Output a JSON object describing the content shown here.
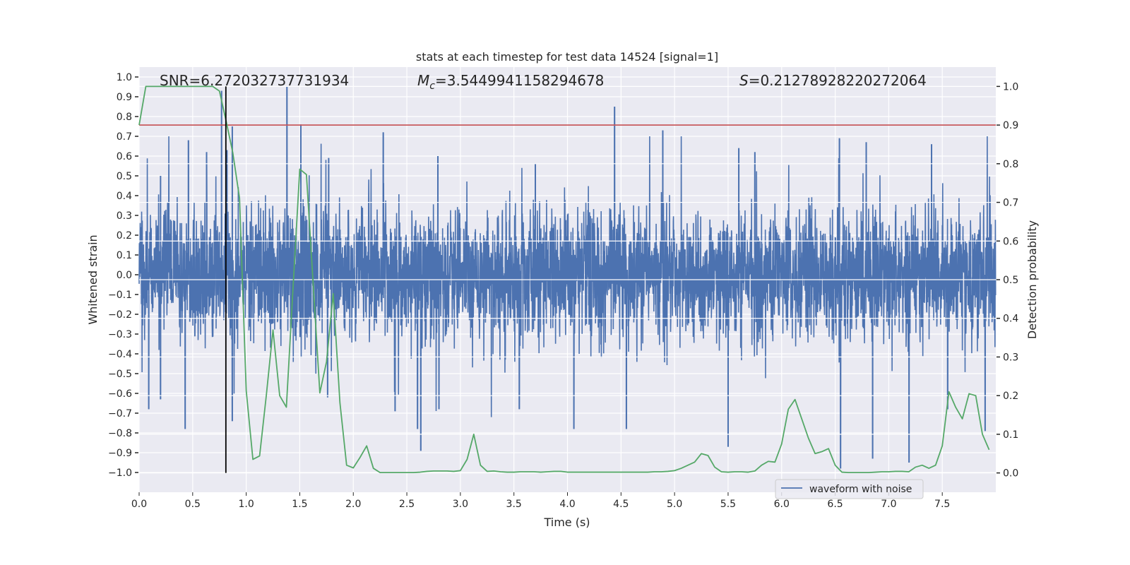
{
  "chart_data": {
    "type": "line",
    "title": "stats at each timestep for test data 14524 [signal=1]",
    "xlabel": "Time (s)",
    "ylabel_left": "Whitened strain",
    "ylabel_right": "Detection probability",
    "xlim": [
      0,
      8
    ],
    "ylim_left": [
      -1.1,
      1.05
    ],
    "ylim_right": [
      -0.05,
      1.05
    ],
    "grid": true,
    "x_ticks": [
      "0.0",
      "0.5",
      "1.0",
      "1.5",
      "2.0",
      "2.5",
      "3.0",
      "3.5",
      "4.0",
      "4.5",
      "5.0",
      "5.5",
      "6.0",
      "6.5",
      "7.0",
      "7.5"
    ],
    "y_ticks_left": [
      "1.0",
      "0.9",
      "0.8",
      "0.7",
      "0.6",
      "0.5",
      "0.4",
      "0.3",
      "0.2",
      "0.1",
      "0.0",
      "−0.1",
      "−0.2",
      "−0.3",
      "−0.4",
      "−0.5",
      "−0.6",
      "−0.7",
      "−0.8",
      "−0.9",
      "−1.0"
    ],
    "y_ticks_right": [
      "1.0",
      "0.9",
      "0.8",
      "0.7",
      "0.6",
      "0.5",
      "0.4",
      "0.3",
      "0.2",
      "0.1",
      "0.0"
    ],
    "annotations": {
      "snr": {
        "text": "SNR=6.272032737731934"
      },
      "mc": {
        "symbol": "M",
        "subscript": "c",
        "value": "=3.5449941158294678"
      },
      "s": {
        "symbol": "S",
        "value": "=0.21278928220272064"
      }
    },
    "legend": {
      "placement": "bottom-right",
      "entries": [
        "waveform with noise"
      ]
    },
    "series": [
      {
        "name": "waveform with noise",
        "axis": "left",
        "color": "#4C72B0",
        "notable_extrema": [
          [
            0.09,
            -0.68
          ],
          [
            0.2,
            0.5
          ],
          [
            0.2,
            -0.63
          ],
          [
            0.43,
            -0.78
          ],
          [
            0.46,
            0.68
          ],
          [
            0.63,
            0.62
          ],
          [
            0.77,
            0.93
          ],
          [
            0.82,
            0.63
          ],
          [
            0.87,
            0.75
          ],
          [
            0.87,
            -0.74
          ],
          [
            1.38,
            0.95
          ],
          [
            1.51,
            0.76
          ],
          [
            1.77,
            0.59
          ],
          [
            1.76,
            -0.62
          ],
          [
            2.28,
            0.72
          ],
          [
            2.39,
            -0.69
          ],
          [
            2.6,
            -0.78
          ],
          [
            2.63,
            -0.89
          ],
          [
            2.79,
            0.6
          ],
          [
            2.8,
            -0.68
          ],
          [
            3.55,
            -0.68
          ],
          [
            3.7,
            0.56
          ],
          [
            4.06,
            -0.78
          ],
          [
            4.44,
            0.85
          ],
          [
            4.55,
            -0.78
          ],
          [
            4.89,
            0.73
          ],
          [
            5.5,
            -0.87
          ],
          [
            5.6,
            0.64
          ],
          [
            5.75,
            0.62
          ],
          [
            6.54,
            0.69
          ],
          [
            6.55,
            -0.98
          ],
          [
            6.79,
            0.67
          ],
          [
            6.85,
            -0.93
          ],
          [
            7.19,
            -0.95
          ],
          [
            7.4,
            0.66
          ],
          [
            7.55,
            -0.68
          ],
          [
            7.9,
            -0.79
          ]
        ]
      },
      {
        "name": "",
        "axis": "right",
        "color": "#55A868",
        "x_step": 0.0625,
        "values": [
          0.9,
          1.0,
          1.0,
          1.0,
          1.0,
          1.0,
          1.0,
          1.0,
          1.0,
          1.0,
          1.0,
          1.0,
          0.988,
          0.91,
          0.828,
          0.711,
          0.213,
          0.035,
          0.044,
          0.2,
          0.37,
          0.2,
          0.17,
          0.48,
          0.786,
          0.772,
          0.49,
          0.207,
          0.288,
          0.464,
          0.182,
          0.02,
          0.013,
          0.04,
          0.07,
          0.012,
          0.001,
          0.001,
          0.001,
          0.001,
          0.001,
          0.001,
          0.002,
          0.004,
          0.005,
          0.005,
          0.005,
          0.004,
          0.006,
          0.035,
          0.1,
          0.02,
          0.004,
          0.005,
          0.003,
          0.002,
          0.002,
          0.003,
          0.003,
          0.003,
          0.002,
          0.003,
          0.004,
          0.004,
          0.002,
          0.002,
          0.002,
          0.002,
          0.002,
          0.002,
          0.002,
          0.002,
          0.002,
          0.002,
          0.002,
          0.002,
          0.002,
          0.003,
          0.003,
          0.004,
          0.006,
          0.012,
          0.02,
          0.028,
          0.05,
          0.045,
          0.015,
          0.003,
          0.002,
          0.003,
          0.003,
          0.002,
          0.005,
          0.02,
          0.03,
          0.028,
          0.075,
          0.165,
          0.19,
          0.14,
          0.09,
          0.05,
          0.055,
          0.063,
          0.02,
          0.002,
          0.001,
          0.001,
          0.001,
          0.001,
          0.002,
          0.003,
          0.003,
          0.004,
          0.004,
          0.003,
          0.015,
          0.02,
          0.012,
          0.02,
          0.07,
          0.21,
          0.17,
          0.14,
          0.205,
          0.2,
          0.1,
          0.06
        ]
      }
    ],
    "threshold": {
      "axis": "right",
      "value": 0.9,
      "color": "#C44E52"
    },
    "marker_line": {
      "x": 0.81,
      "from": 0.0,
      "to": 1.0,
      "axis": "right",
      "color": "#000000"
    },
    "colors": {
      "background": "#EAEAF2",
      "grid": "#FFFFFF"
    }
  }
}
